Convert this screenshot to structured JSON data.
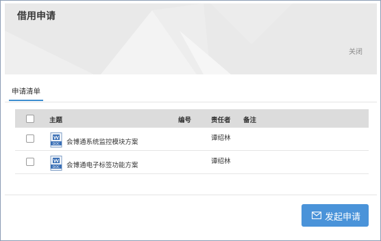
{
  "dialog": {
    "title": "借用申请",
    "close_label": "关闭"
  },
  "tabs": [
    {
      "label": "申请清单"
    }
  ],
  "table": {
    "columns": {
      "subject": "主题",
      "number": "编号",
      "owner": "责任者",
      "remarks": "备注"
    },
    "rows": [
      {
        "subject": "会博通系统监控模块方案",
        "number": "",
        "owner": "谭绍林",
        "remarks": "",
        "icon": "doc-file-icon"
      },
      {
        "subject": "会博通电子标签功能方案",
        "number": "",
        "owner": "谭绍林",
        "remarks": "",
        "icon": "doc-file-icon"
      }
    ]
  },
  "footer": {
    "submit_label": "发起申请",
    "submit_icon": "mail-icon"
  },
  "colors": {
    "accent": "#4a93d9",
    "tab_underline": "#3c8dcf",
    "header_bg": "#e9e9e9",
    "table_header_bg": "#dcdcdc"
  }
}
